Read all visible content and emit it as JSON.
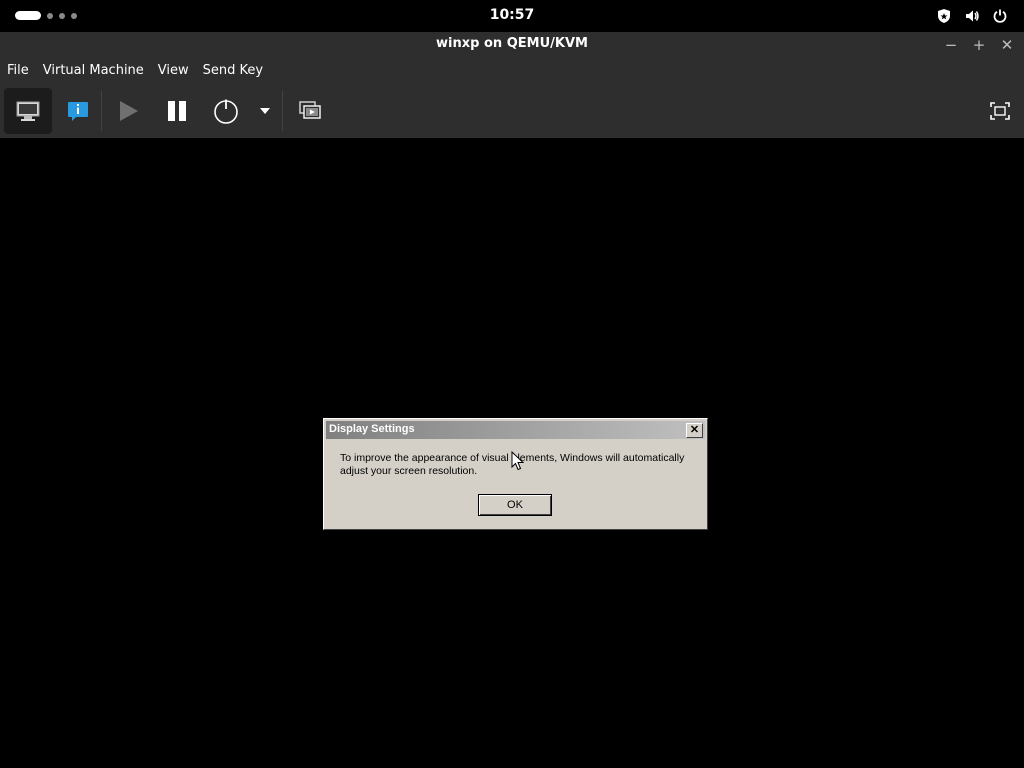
{
  "topbar": {
    "clock": "10:57",
    "icons": [
      "shield-icon",
      "volume-icon",
      "power-icon"
    ]
  },
  "window": {
    "title": "winxp on QEMU/KVM",
    "controls": {
      "minimize": "−",
      "maximize": "+",
      "close": "✕"
    }
  },
  "menubar": {
    "items": [
      "File",
      "Virtual Machine",
      "View",
      "Send Key"
    ]
  },
  "toolbar": {
    "buttons": [
      "console-icon",
      "details-info-icon",
      "run-icon",
      "pause-icon",
      "shutdown-icon",
      "shutdown-menu-arrow-icon",
      "snapshots-icon",
      "fullscreen-icon"
    ],
    "accent": "#2a9ae0"
  },
  "dialog": {
    "title": "Display Settings",
    "close_label": "✕",
    "message": "To improve the appearance of visual elements, Windows will automatically adjust your screen resolution.",
    "ok_label": "OK"
  }
}
